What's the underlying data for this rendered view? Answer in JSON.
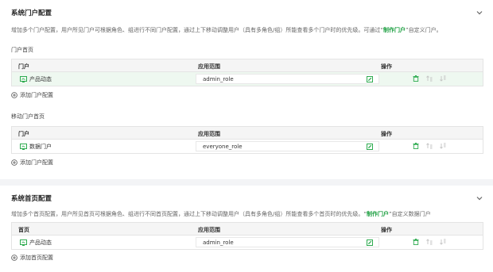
{
  "portal_section": {
    "title": "系统门户配置",
    "desc_prefix": "增加多个门户配置，用户所见门户可根据角色、组进行不同门户配置，通过上下移动调整用户（具有多角色/组）所能查看多个门户时的优先级。可通过“",
    "desc_link": "制作门户",
    "desc_suffix": "”自定义门户。",
    "columns": {
      "name": "门户",
      "scope": "应用范围",
      "ops": "操作"
    },
    "home": {
      "label": "门户首页",
      "rows": [
        {
          "name": "产品动态",
          "role": "admin_role",
          "selected": true
        }
      ],
      "add_label": "添加门户配置"
    },
    "mobile": {
      "label": "移动门户首页",
      "rows": [
        {
          "name": "数据门户",
          "role": "everyone_role",
          "selected": false
        }
      ],
      "add_label": "添加门户配置"
    }
  },
  "home_section": {
    "title": "系统首页配置",
    "desc_prefix": "增加多个首页配置，用户所见首页可根据角色、组进行不同首页配置，通过上下移动调整用户（具有多角色/组）所能查看多个首页时的优先级。“",
    "desc_link": "制作门户",
    "desc_suffix": "”自定义数据门户",
    "columns": {
      "name": "首页",
      "scope": "应用范围",
      "ops": "操作"
    },
    "rows": [
      {
        "name": "产品动态",
        "role": "admin_role",
        "selected": false
      }
    ],
    "add_label": "添加首页配置"
  },
  "colors": {
    "accent": "#1a9e3f",
    "icon_green": "#2dab4f",
    "icon_gray": "#c4c4c4"
  },
  "icons": [
    "chevron-down-icon",
    "portal-icon",
    "edit-icon",
    "delete-icon",
    "move-up-icon",
    "move-down-icon",
    "add-circle-icon"
  ]
}
